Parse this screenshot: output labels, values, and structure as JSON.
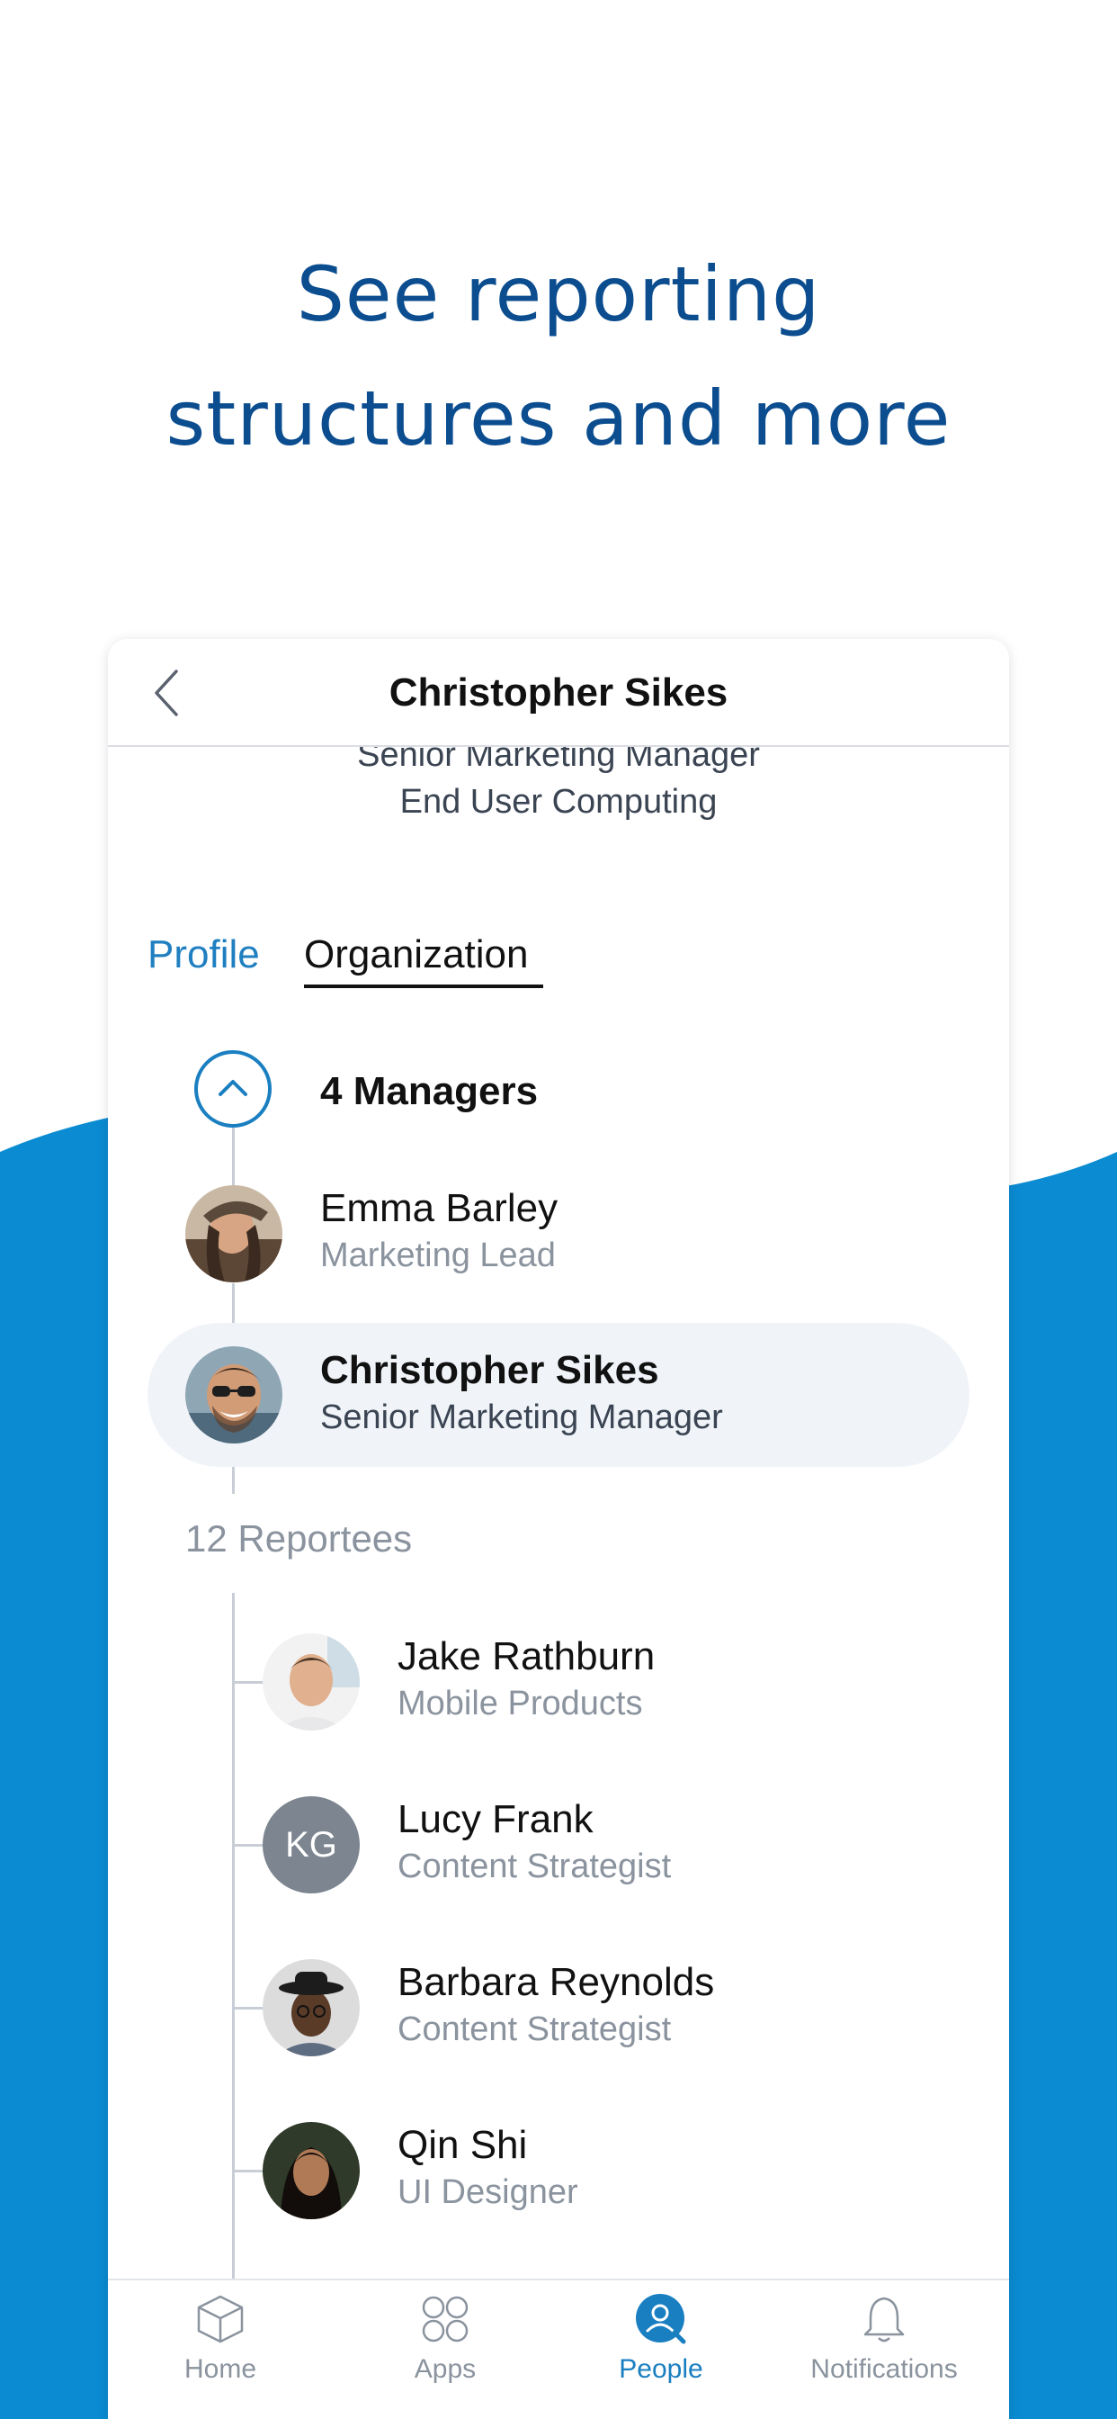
{
  "headline": {
    "line1": "See reporting",
    "line2": "structures and more"
  },
  "header": {
    "title": "Christopher Sikes",
    "back_icon": "chevron-left-icon"
  },
  "profile": {
    "job_title": "Senior Marketing Manager",
    "department": "End User Computing"
  },
  "tabs": [
    {
      "label": "Profile",
      "active": false
    },
    {
      "label": "Organization",
      "active": true
    }
  ],
  "managers": {
    "label": "4 Managers",
    "toggle_icon": "chevron-up-icon",
    "people": [
      {
        "name": "Emma Barley",
        "role": "Marketing Lead"
      },
      {
        "name": "Christopher Sikes",
        "role": "Senior Marketing Manager",
        "current": true
      }
    ]
  },
  "reportees": {
    "label": "12 Reportees",
    "people": [
      {
        "name": "Jake Rathburn",
        "role": "Mobile Products"
      },
      {
        "name": "Lucy Frank",
        "role": "Content Strategist",
        "initials": "KG"
      },
      {
        "name": "Barbara Reynolds",
        "role": "Content Strategist"
      },
      {
        "name": "Qin Shi",
        "role": "UI Designer"
      }
    ]
  },
  "tabbar": {
    "items": [
      {
        "label": "Home",
        "icon": "cube-icon",
        "active": false
      },
      {
        "label": "Apps",
        "icon": "apps-grid-icon",
        "active": false
      },
      {
        "label": "People",
        "icon": "person-search-icon",
        "active": true
      },
      {
        "label": "Notifications",
        "icon": "bell-icon",
        "active": false
      }
    ]
  },
  "colors": {
    "brand_blue": "#0a8bd2",
    "headline": "#0b4d8f",
    "accent": "#1a7fc1",
    "highlight_row": "#f0f4f9",
    "muted_text": "#8a939e"
  }
}
